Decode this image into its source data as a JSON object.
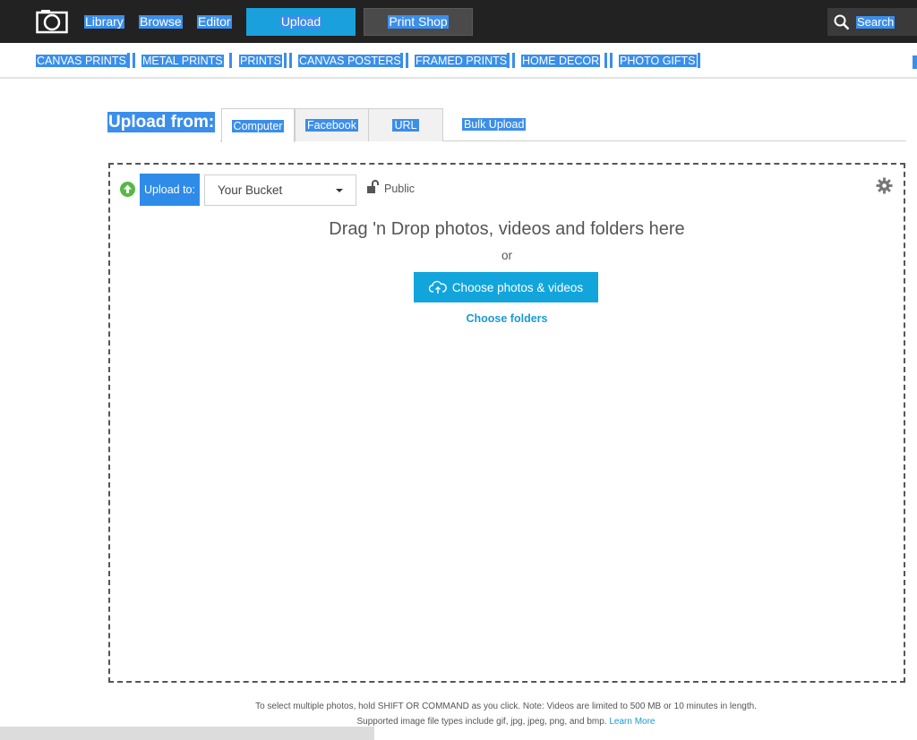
{
  "topnav": {
    "library": "Library",
    "browse": "Browse",
    "editor": "Editor",
    "upload": "Upload",
    "print_shop": "Print Shop",
    "search": "Search"
  },
  "subnav": {
    "items": [
      "CANVAS PRINTS",
      "METAL PRINTS",
      "PRINTS",
      "CANVAS POSTERS",
      "FRAMED PRINTS",
      "HOME DECOR",
      "PHOTO GIFTS"
    ]
  },
  "upload_from": {
    "label": "Upload from:",
    "tabs": [
      "Computer",
      "Facebook",
      "URL"
    ],
    "bulk": "Bulk Upload"
  },
  "uploader": {
    "upload_to_label": "Upload to:",
    "bucket_value": "Your Bucket",
    "privacy": "Public",
    "drag_text": "Drag 'n Drop photos, videos and folders here",
    "or_text": "or",
    "choose_button": "Choose photos & videos",
    "choose_folders": "Choose folders"
  },
  "footer": {
    "line1": "To select multiple photos, hold SHIFT OR COMMAND as you click. Note: Videos are limited to 500 MB or 10 minutes in length.",
    "line2": "Supported image file types include gif, jpg, jpeg, png, and bmp.",
    "learn_more": "Learn More"
  },
  "colors": {
    "topbar": "#222222",
    "upload_button": "#1aa0db",
    "selection": "#3b8eea",
    "link": "#1a9ad6"
  }
}
